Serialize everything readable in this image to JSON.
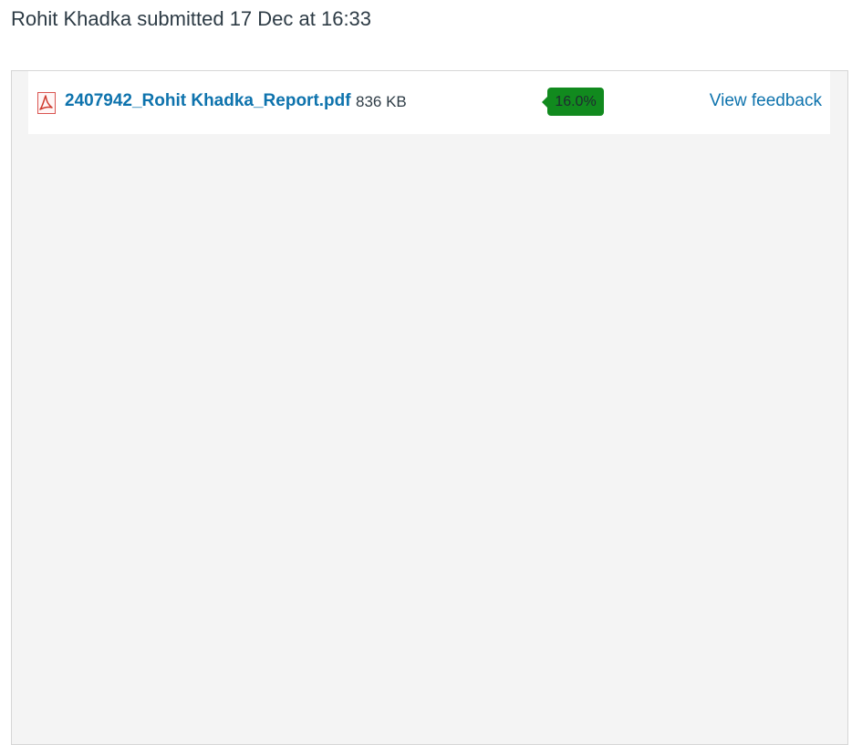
{
  "submission": {
    "header_text": "Rohit Khadka submitted 17 Dec at 16:33"
  },
  "file": {
    "name": "2407942_Rohit Khadka_Report.pdf",
    "size": "836 KB",
    "icon": "pdf-file-icon"
  },
  "similarity": {
    "score_text": "16.0%",
    "badge_color": "#118a1e"
  },
  "actions": {
    "view_feedback_label": "View feedback"
  },
  "colors": {
    "link": "#0e73ad",
    "text": "#2d3b45",
    "panel_background": "#f4f4f4"
  }
}
